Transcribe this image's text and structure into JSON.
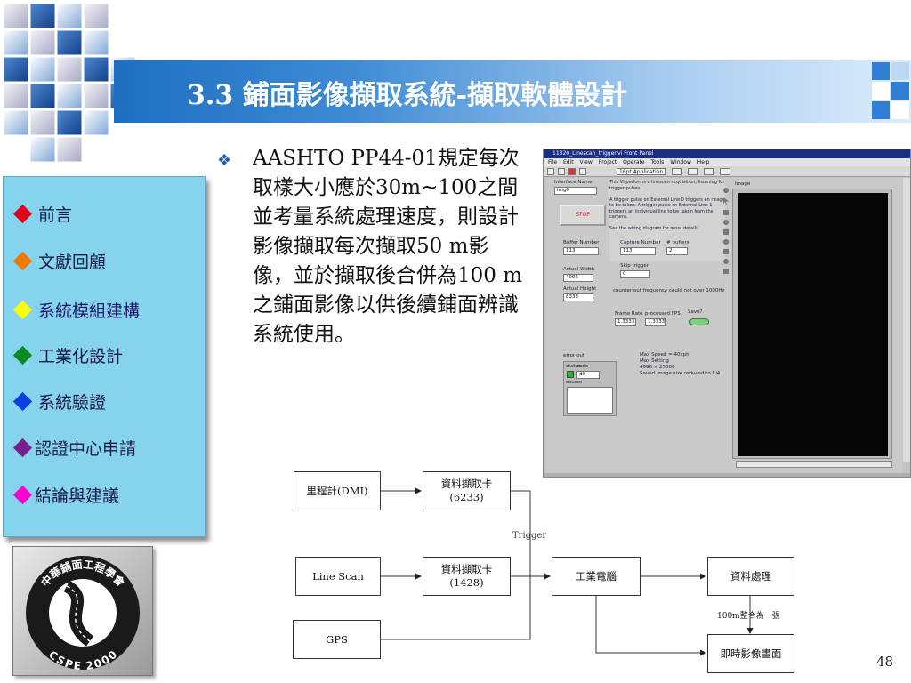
{
  "slide": {
    "title": "3.3 鋪面影像擷取系統-擷取軟體設計",
    "page_number": "48"
  },
  "sidebar": {
    "items": [
      {
        "label": "前言",
        "color": "#e0001b"
      },
      {
        "label": "文獻回顧",
        "color": "#f07a00"
      },
      {
        "label": "系統模組建構",
        "color": "#ffff00"
      },
      {
        "label": "工業化設計",
        "color": "#0a8a1e"
      },
      {
        "label": "系統驗證",
        "color": "#0a3fe0"
      },
      {
        "label": "認證中心申請",
        "color": "#7b1d8c"
      },
      {
        "label": "結論與建議",
        "color": "#ff00d0"
      }
    ]
  },
  "logo": {
    "top_text": "中華鋪面工程學會",
    "bottom_text": "CSPE 2000"
  },
  "content": {
    "bullet_symbol": "❖",
    "text": "AASHTO PP44-01規定每次取樣大小應於30m~100之間並考量系統處理速度，則設計影像擷取每次擷取50 m影像，並於擷取後合併為100 m之鋪面影像以供後續鋪面辨識系統使用。"
  },
  "labview": {
    "window_title": "11320_Linescan_trigger.vi Front Panel",
    "menu": [
      "File",
      "Edit",
      "View",
      "Project",
      "Operate",
      "Tools",
      "Window",
      "Help"
    ],
    "font_dropdown": "16pt Application Font",
    "interface_name_label": "Interface Name",
    "interface_name_value": "img0",
    "stop_label": "STOP",
    "description": "This VI performs a linescan acquisition, listening for trigger pulses.\n\nA trigger pulse on External Line 0 triggers an image to be taken. A trigger pulse on External Line 1 triggers an individual line to be taken from the camera.\n\nSee the wiring diagram for more details.",
    "image_label": "Image",
    "buffer_number_label": "Buffer Number",
    "buffer_number_value": "113",
    "capture_number_label": "Capture Number",
    "capture_number_value": "113",
    "num_buffers_label": "# buffers",
    "num_buffers_value": "2",
    "skip_trigger_label": "Skip trigger",
    "skip_trigger_value": "0",
    "actual_width_label": "Actual Width",
    "actual_width_value": "4096",
    "actual_height_label": "Actual Height",
    "actual_height_value": "8333",
    "counter_note": "counter out frequency could not over 1000Hz",
    "frame_rate_label": "Frame Rate",
    "frame_rate_value": "1.33333",
    "processed_fps_label": "processed FPS",
    "processed_fps_value": "1.33333",
    "save_label": "Save?",
    "error_out_label": "error out",
    "status_label": "status",
    "code_label": "code",
    "code_value": "d0",
    "source_label": "source",
    "speed_note": "Max Speed = 40kph\nMax Setting\n4096 × 25000\nSaved image size reduced to 1/4"
  },
  "diagram": {
    "dmi": "里程計(DMI)",
    "card_6233": "資料擷取卡\n(6233)",
    "trigger_label": "Trigger",
    "line_scan": "Line Scan",
    "card_1428": "資料擷取卡\n(1428)",
    "pc": "工業電腦",
    "data_processing": "資料處理",
    "merge_label": "100m整合為一張",
    "gps": "GPS",
    "realtime_display": "即時影像畫面"
  }
}
